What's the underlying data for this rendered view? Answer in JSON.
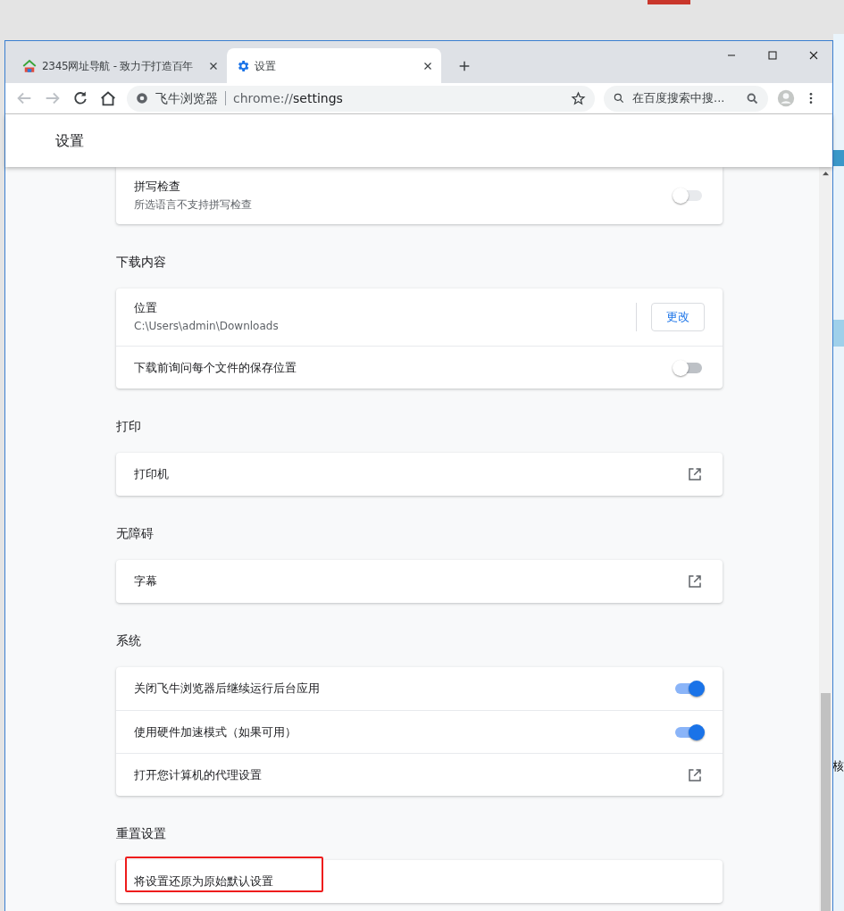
{
  "background_page": {
    "edge_text": "核"
  },
  "window": {
    "tabs": [
      {
        "title": "2345网址导航 - 致力于打造百年",
        "selected": false
      },
      {
        "title": "设置",
        "selected": true
      }
    ]
  },
  "toolbar": {
    "site_label": "飞牛浏览器",
    "url_scheme": "chrome://",
    "url_path": "settings",
    "search_placeholder": "在百度搜索中搜..."
  },
  "header": {
    "title": "设置"
  },
  "sections": [
    {
      "rows": [
        {
          "kind": "toggle",
          "label": "拼写检查",
          "sublabel": "所选语言不支持拼写检查",
          "on": false,
          "disabled": true
        }
      ]
    },
    {
      "title": "下载内容",
      "rows": [
        {
          "kind": "button",
          "label": "位置",
          "sublabel": "C:\\Users\\admin\\Downloads",
          "button": "更改"
        },
        {
          "kind": "toggle",
          "label": "下载前询问每个文件的保存位置",
          "on": false,
          "disabled": false
        }
      ]
    },
    {
      "title": "打印",
      "rows": [
        {
          "kind": "link",
          "label": "打印机"
        }
      ]
    },
    {
      "title": "无障碍",
      "rows": [
        {
          "kind": "link",
          "label": "字幕"
        }
      ]
    },
    {
      "title": "系统",
      "rows": [
        {
          "kind": "toggle",
          "label": "关闭飞牛浏览器后继续运行后台应用",
          "on": true
        },
        {
          "kind": "toggle",
          "label": "使用硬件加速模式（如果可用）",
          "on": true
        },
        {
          "kind": "link",
          "label": "打开您计算机的代理设置"
        }
      ]
    },
    {
      "title": "重置设置",
      "rows": [
        {
          "kind": "plain",
          "label": "将设置还原为原始默认设置",
          "highlighted": true
        }
      ]
    }
  ]
}
